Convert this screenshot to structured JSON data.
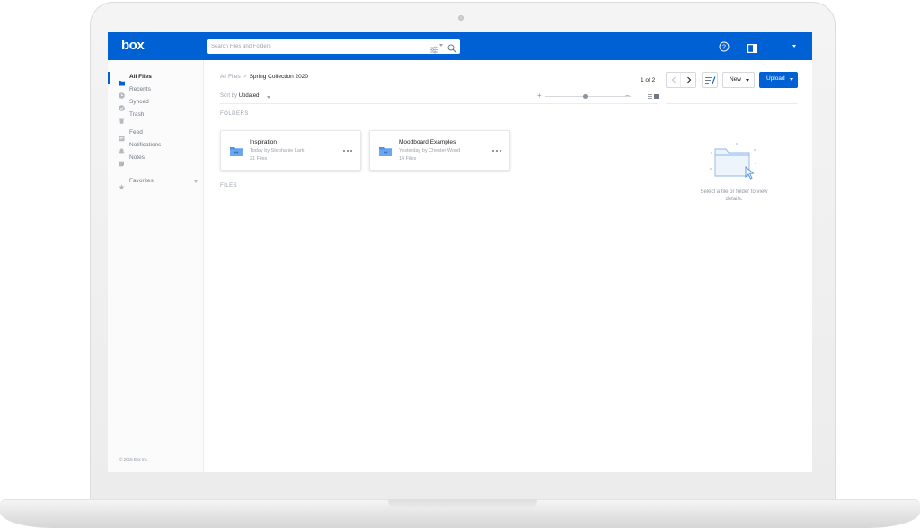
{
  "app": {
    "brand": "box",
    "accent_color": "#0061d5"
  },
  "header": {
    "search_placeholder": "Search Files and Folders",
    "icons": [
      "filter-icon",
      "search-icon",
      "help-icon",
      "preview-panel-icon",
      "account-menu-icon"
    ]
  },
  "sidebar": {
    "items": [
      {
        "label": "All Files",
        "icon": "folder-icon",
        "active": true
      },
      {
        "label": "Recents",
        "icon": "clock-icon",
        "active": false
      },
      {
        "label": "Synced",
        "icon": "check-circle-icon",
        "active": false
      },
      {
        "label": "Trash",
        "icon": "trash-icon",
        "active": false
      },
      {
        "label": "Feed",
        "icon": "feed-icon",
        "active": false
      },
      {
        "label": "Notifications",
        "icon": "bell-icon",
        "active": false
      },
      {
        "label": "Notes",
        "icon": "notes-icon",
        "active": false
      },
      {
        "label": "Favorites",
        "icon": "star-icon",
        "active": false
      }
    ],
    "copyright": "© 2018 Box Inc."
  },
  "breadcrumb": {
    "root": "All Files",
    "separator": ">",
    "current": "Spring Collection 2020"
  },
  "sort": {
    "label": "Sort by",
    "value": "Updated"
  },
  "view": {
    "zoom_minus": "+",
    "zoom_plus": "−",
    "mode": "grid"
  },
  "pagination": {
    "text": "1 of 2"
  },
  "toolbar": {
    "new_label": "New",
    "upload_label": "Upload"
  },
  "sections": {
    "folders": "FOLDERS",
    "files": "FILES"
  },
  "folders": [
    {
      "name": "Inspiration",
      "meta": "Today by Stephanie Lark",
      "count": "21 Files"
    },
    {
      "name": "Moodboard Examples",
      "meta": "Yesterday by Chester Wood",
      "count": "14 Files"
    }
  ],
  "details": {
    "hint": "Select a file or folder to view details."
  }
}
